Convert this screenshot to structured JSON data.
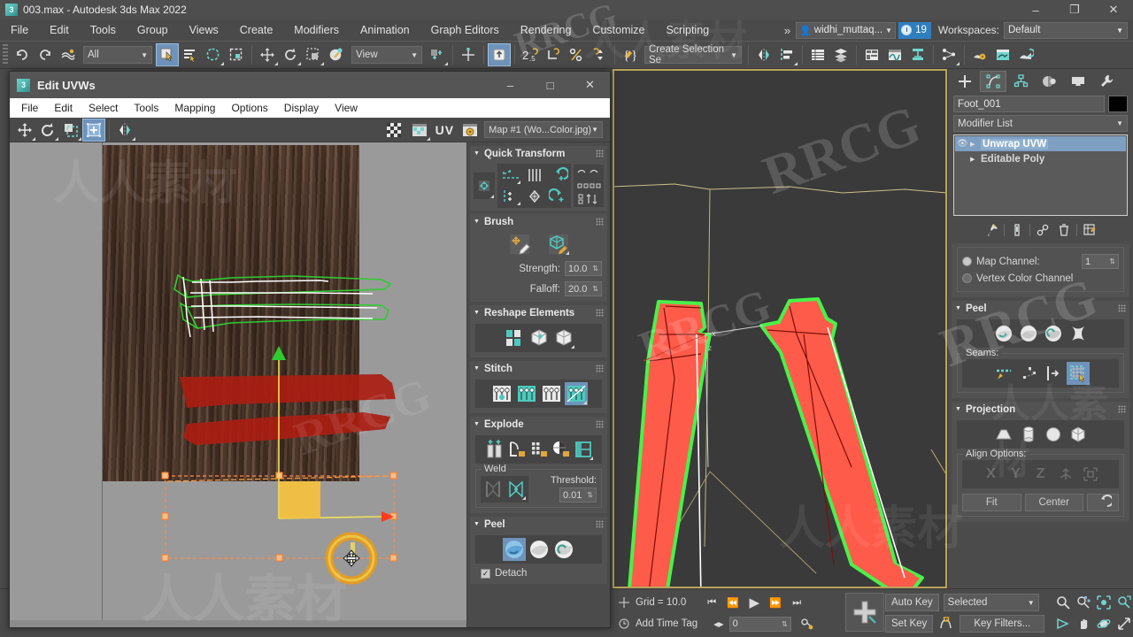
{
  "titlebar": {
    "app_title": "003.max - Autodesk 3ds Max 2022",
    "icon": "max-app-icon",
    "minimize": "–",
    "maximize": "❐",
    "close": "✕"
  },
  "menubar": {
    "items": [
      "File",
      "Edit",
      "Tools",
      "Group",
      "Views",
      "Create",
      "Modifiers",
      "Animation",
      "Graph Editors",
      "Rendering",
      "Customize",
      "Scripting"
    ],
    "overflow": "»",
    "user_name": "widhi_muttaq...",
    "clock_count": "19",
    "workspaces_label": "Workspaces:",
    "workspace_value": "Default"
  },
  "main_toolbar": {
    "selection_filter": "All",
    "reference_coord": "View",
    "named_selection": "Create Selection Se",
    "angle_snap": "2.5",
    "icons": [
      "undo-icon",
      "redo-icon",
      "select-link-icon",
      "unlink-icon",
      "bind-spacewarp-icon",
      "select-object-icon",
      "select-by-name-icon",
      "rect-select-icon",
      "window-crossing-icon",
      "select-move-icon",
      "select-rotate-icon",
      "select-scale-icon",
      "placement-icon",
      "use-center-icon",
      "mirror-icon",
      "align-icon",
      "snaps-toggle-icon",
      "angle-snap-icon",
      "percent-snap-icon",
      "spinner-snap-icon",
      "edit-named-sets-icon",
      "mirror-tool-icon",
      "align-tool-icon",
      "layer-explorer-icon",
      "scene-explorer-icon",
      "ribbon-icon",
      "curve-editor-icon",
      "schematic-view-icon",
      "material-editor-icon",
      "render-setup-icon",
      "render-frame-icon",
      "render-production-icon"
    ]
  },
  "edit_uvws": {
    "title": "Edit UVWs",
    "window_icon": "max-app-icon",
    "minimize": "–",
    "maximize": "□",
    "close": "✕",
    "menu": [
      "File",
      "Edit",
      "Select",
      "Tools",
      "Mapping",
      "Options",
      "Display",
      "View"
    ],
    "toolbar_icons": [
      "move-icon",
      "rotate-icon",
      "freeform-mode-icon",
      "mirror-icon",
      "show-map-icon"
    ],
    "uv_label": "UV",
    "map_selector": "Map #1 (Wo...Color.jpg)",
    "rollups": [
      {
        "name": "Quick Transform",
        "id": "quick-transform",
        "icons": [
          "align-horizontal-icon",
          "straighten-vertical-icon",
          "rotate-ccw-icon",
          "space-horizontal-icon",
          "space-vertical-icon",
          "align-vertical-icon",
          "relax-icon",
          "rotate-cw-icon",
          "flip-horizontal-icon",
          "flip-vertical-icon"
        ]
      },
      {
        "name": "Brush",
        "id": "brush",
        "strength_label": "Strength:",
        "strength_value": "10.0",
        "falloff_label": "Falloff:",
        "falloff_value": "20.0",
        "icons": [
          "paint-move-brush-icon",
          "relax-brush-icon",
          "brush-options-icon"
        ]
      },
      {
        "name": "Reshape Elements",
        "id": "reshape-elements",
        "icons": [
          "reshape-grid-icon",
          "reshape-box-sync-icon",
          "reshape-box-icon"
        ]
      },
      {
        "name": "Stitch",
        "id": "stitch",
        "icons": [
          "stitch-custom-icon",
          "stitch-source-icon",
          "stitch-target-icon",
          "stitch-diagonal-icon"
        ]
      },
      {
        "name": "Explode",
        "id": "explode",
        "icons": [
          "explode-by-element-icon",
          "explode-by-angle-icon",
          "explode-by-material-icon",
          "explode-by-face-icon",
          "explode-by-poly-icon"
        ],
        "weld_label": "Weld",
        "weld_icons": [
          "weld-selected-icon",
          "weld-target-icon"
        ],
        "threshold_label": "Threshold:",
        "threshold_value": "0.01"
      },
      {
        "name": "Peel",
        "id": "peel-uvw",
        "icons": [
          "peel-mode-icon",
          "quick-peel-icon",
          "pelt-map-icon"
        ],
        "detach_label": "Detach",
        "detach_checked": true
      }
    ]
  },
  "viewport": {
    "label": "",
    "grid_label": "Grid = 10.0"
  },
  "command_panel": {
    "tabs": [
      "create-tab",
      "modify-tab",
      "hierarchy-tab",
      "motion-tab",
      "display-tab",
      "utilities-tab"
    ],
    "active_tab_index": 1,
    "object_name": "Foot_001",
    "color_swatch": "#000000",
    "modifier_list_label": "Modifier List",
    "stack": [
      {
        "label": "Unwrap UVW",
        "selected": true,
        "eye": "◉"
      },
      {
        "label": "Editable Poly",
        "selected": false,
        "eye": ""
      }
    ],
    "stack_buttons": [
      "pin-stack-icon",
      "show-end-result-icon",
      "make-unique-icon",
      "remove-modifier-icon",
      "configure-sets-icon"
    ],
    "channel": {
      "map_channel_label": "Map Channel:",
      "map_channel_value": "1",
      "map_channel_selected": true,
      "vertex_color_label": "Vertex Color Channel",
      "vertex_color_selected": false
    },
    "peel": {
      "title": "Peel",
      "icons": [
        "peel-mode-icon",
        "quick-peel-icon",
        "pelt-map-icon",
        "relax-icon"
      ],
      "seams_label": "Seams:",
      "seam_icons": [
        "edit-seams-icon",
        "point-to-point-seam-icon",
        "edge-sel-to-seam-icon",
        "exp-face-sel-to-seam-icon"
      ]
    },
    "projection": {
      "title": "Projection",
      "icons": [
        "planar-map-icon",
        "cylindrical-map-icon",
        "spherical-map-icon",
        "box-map-icon"
      ],
      "align_label": "Align Options:",
      "align_buttons": [
        "X",
        "Y",
        "Z",
        "align-normal-icon",
        "best-align-icon"
      ],
      "fit_label": "Fit",
      "center_label": "Center",
      "reset_icon": "reset-arrow-icon"
    }
  },
  "statusbar": {
    "grid_label": "Grid = 10.0",
    "add_time_tag": "Add Time Tag",
    "transport": [
      "go-to-start-icon",
      "previous-frame-icon",
      "play-icon",
      "next-frame-icon",
      "go-to-end-icon"
    ],
    "frame_value": "0",
    "key_mode_icon": "key-mode-toggle-icon",
    "add_time_tag_icon": "time-tag-icon",
    "big_button_icon": "add-keys-icon",
    "auto_key_label": "Auto Key",
    "set_key_label": "Set Key",
    "selected_label": "Selected",
    "key_filters_label": "Key Filters...",
    "nav_icons": [
      "zoom-icon",
      "zoom-all-icon",
      "zoom-extents-icon",
      "zoom-region-icon",
      "pan-icon",
      "orbit-icon",
      "field-of-view-icon",
      "maximize-viewport-icon"
    ]
  },
  "watermarks": [
    "RRCG",
    "人人素材"
  ],
  "colors": {
    "accent_blue": "#6f93ba",
    "teal": "#5fc8c0",
    "amber": "#e3b23c",
    "panel_bg": "#4b4b4b",
    "viewport_bg": "#3a3a3a",
    "selection_red": "#ff5b4a",
    "selection_green": "#49f14a",
    "gizmo_orange": "#ff8a2b"
  }
}
